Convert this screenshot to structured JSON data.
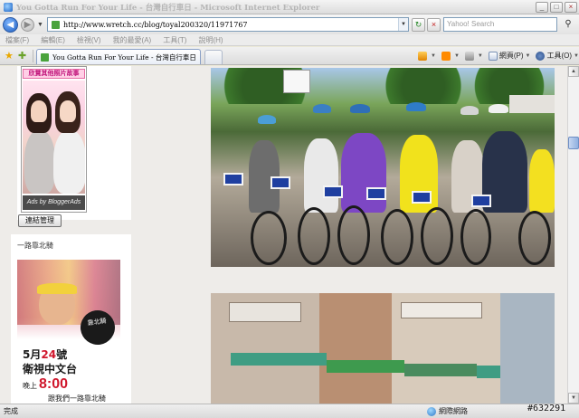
{
  "window": {
    "title": "You Gotta Run For Your Life - 台灣自行車日 - Microsoft Internet Explorer",
    "controls": [
      "_",
      "□",
      "×"
    ]
  },
  "address_bar": {
    "url": "http://www.wretch.cc/blog/toyal200320/11971767",
    "search_placeholder": "Yahoo! Search",
    "refresh_symbol": "↻",
    "stop_symbol": "×"
  },
  "menu": [
    "檔案(F)",
    "編輯(E)",
    "檢視(V)",
    "我的最愛(A)",
    "工具(T)",
    "說明(H)"
  ],
  "tab": {
    "title": "You Gotta Run For Your Life - 台灣自行車日"
  },
  "command_bar": {
    "page_label": "網頁(P)",
    "tools_label": "工具(O)",
    "more": "»"
  },
  "sidebar": {
    "ad1": {
      "header": "欣賞其他照片故事",
      "footer": "Ads by BloggerAds"
    },
    "manage_button": "連結管理",
    "section_title": "一路靠北騎",
    "ad2": {
      "badge": "靠北騎",
      "date_prefix": "5月",
      "date_day": "24",
      "date_suffix": "號",
      "channel": "衛視中文台",
      "time_prefix": "晚上",
      "time": "8:00",
      "slogan": "跟我們一路靠北騎"
    }
  },
  "status_bar": {
    "status": "完成",
    "zone": "網際網路"
  },
  "watermark": "#632291"
}
